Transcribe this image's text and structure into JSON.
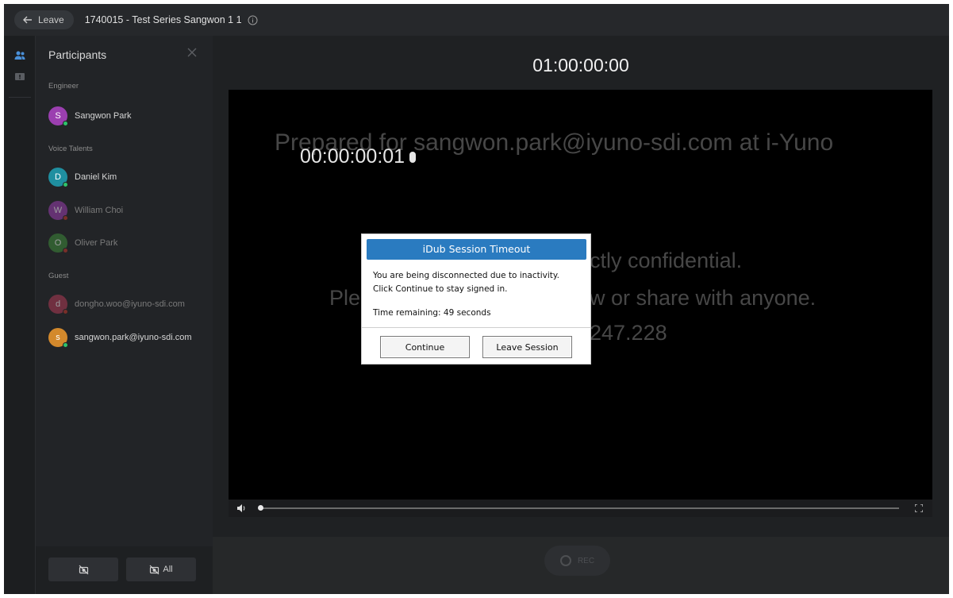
{
  "topbar": {
    "leave_label": "Leave",
    "session_title": "1740015 - Test Series Sangwon 1 1"
  },
  "panel": {
    "title": "Participants",
    "sections": {
      "engineer": "Engineer",
      "voice_talents": "Voice Talents",
      "guest": "Guest"
    },
    "participants": [
      {
        "initial": "S",
        "name": "Sangwon Park",
        "color": "#9b3fb0",
        "status": "#2ec46b"
      },
      {
        "initial": "D",
        "name": "Daniel Kim",
        "color": "#1f8fa0",
        "status": "#2ec46b"
      },
      {
        "initial": "W",
        "name": "William Choi",
        "color": "#9b3fb0",
        "status": "#c0392b"
      },
      {
        "initial": "O",
        "name": "Oliver Park",
        "color": "#3f8a3a",
        "status": "#c0392b"
      },
      {
        "initial": "d",
        "name": "dongho.woo@iyuno-sdi.com",
        "color": "#b03a55",
        "status": "#c0392b"
      },
      {
        "initial": "s",
        "name": "sangwon.park@iyuno-sdi.com",
        "color": "#d3892c",
        "status": "#2ec46b"
      }
    ],
    "footer": {
      "all_label": "All"
    }
  },
  "main": {
    "timecode_top": "01:00:00:00",
    "video": {
      "timecode": "00:00:00:01",
      "watermark_line1": "Prepared for sangwon.park@iyuno-sdi.com at i-Yuno",
      "watermark_line2": "ctly confidential.",
      "watermark_line3_left": "Ple",
      "watermark_line3_right": "w or share with anyone.",
      "watermark_line4": "247.228"
    },
    "rec_label": "REC"
  },
  "modal": {
    "title": "iDub Session Timeout",
    "message_line1": "You are being disconnected due to inactivity.",
    "message_line2": "Click Continue to stay signed in.",
    "time_remaining": "Time remaining: 49 seconds",
    "continue_label": "Continue",
    "leave_session_label": "Leave Session"
  },
  "colors": {
    "accent": "#2a7bc0",
    "online": "#2ec46b",
    "offline": "#c0392b"
  }
}
